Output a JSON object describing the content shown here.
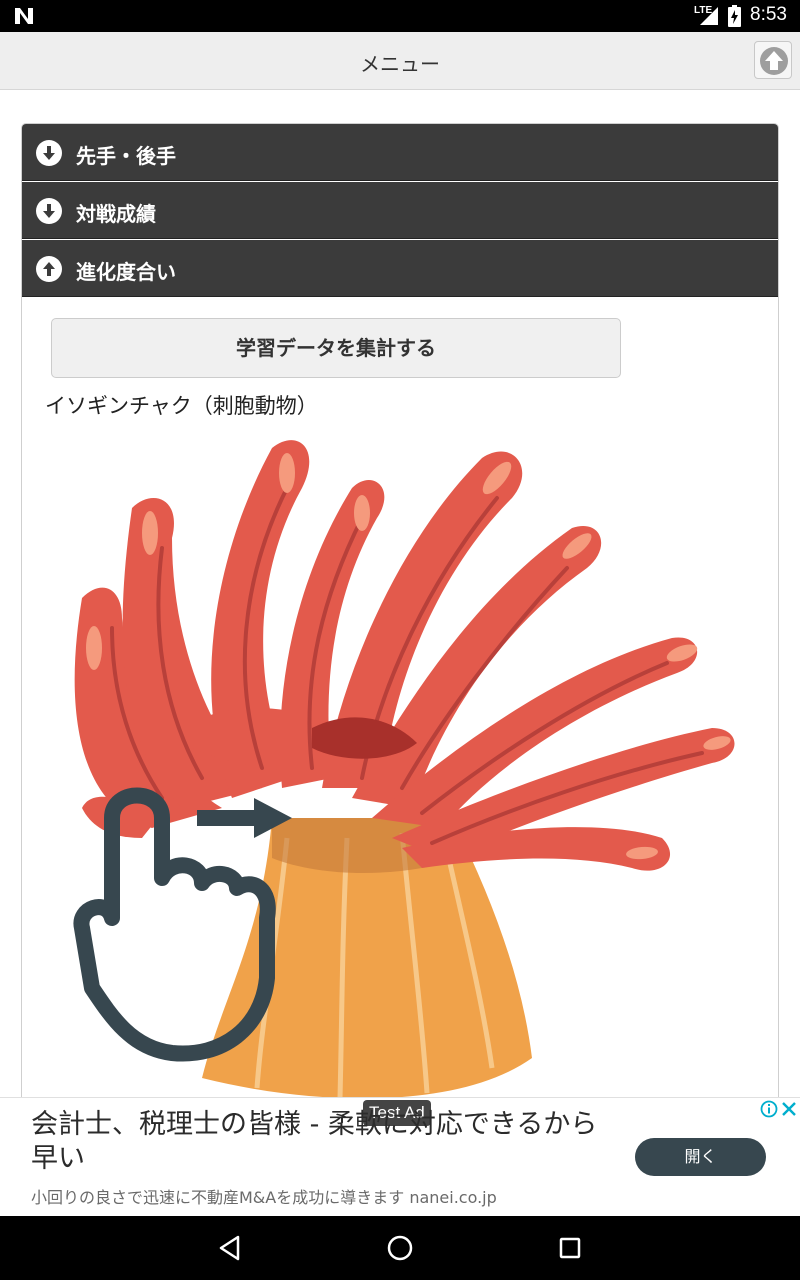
{
  "status_bar": {
    "network_label": "LTE",
    "time": "8:53"
  },
  "app_bar": {
    "title": "メニュー"
  },
  "accordion": [
    {
      "label": "先手・後手",
      "state": "collapsed"
    },
    {
      "label": "対戦成績",
      "state": "collapsed"
    },
    {
      "label": "進化度合い",
      "state": "expanded"
    }
  ],
  "evolution": {
    "aggregate_button": "学習データを集計する",
    "creature_caption": "イソギンチャク（刺胞動物）"
  },
  "ad": {
    "tag": "Test Ad",
    "headline": "会計士、税理士の皆様 - 柔軟に対応できるから早い",
    "description": "小回りの良さで迅速に不動産M&Aを成功に導きます nanei.co.jp",
    "cta": "開く"
  },
  "colors": {
    "accordion_header": "#3b3b3b",
    "tentacle_red": "#e35a4c",
    "body_orange": "#f0a24a",
    "ad_button": "#37474f"
  }
}
